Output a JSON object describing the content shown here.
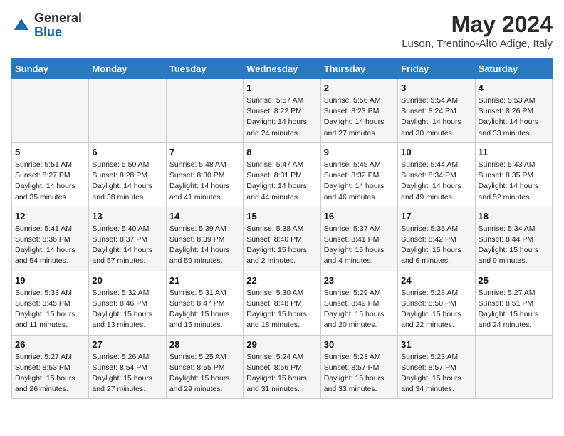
{
  "header": {
    "logo_general": "General",
    "logo_blue": "Blue",
    "month_title": "May 2024",
    "location": "Luson, Trentino-Alto Adige, Italy"
  },
  "days_of_week": [
    "Sunday",
    "Monday",
    "Tuesday",
    "Wednesday",
    "Thursday",
    "Friday",
    "Saturday"
  ],
  "weeks": [
    [
      {
        "day": "",
        "sunrise": "",
        "sunset": "",
        "daylight": ""
      },
      {
        "day": "",
        "sunrise": "",
        "sunset": "",
        "daylight": ""
      },
      {
        "day": "",
        "sunrise": "",
        "sunset": "",
        "daylight": ""
      },
      {
        "day": "1",
        "sunrise": "Sunrise: 5:57 AM",
        "sunset": "Sunset: 8:22 PM",
        "daylight": "Daylight: 14 hours and 24 minutes."
      },
      {
        "day": "2",
        "sunrise": "Sunrise: 5:56 AM",
        "sunset": "Sunset: 8:23 PM",
        "daylight": "Daylight: 14 hours and 27 minutes."
      },
      {
        "day": "3",
        "sunrise": "Sunrise: 5:54 AM",
        "sunset": "Sunset: 8:24 PM",
        "daylight": "Daylight: 14 hours and 30 minutes."
      },
      {
        "day": "4",
        "sunrise": "Sunrise: 5:53 AM",
        "sunset": "Sunset: 8:26 PM",
        "daylight": "Daylight: 14 hours and 33 minutes."
      }
    ],
    [
      {
        "day": "5",
        "sunrise": "Sunrise: 5:51 AM",
        "sunset": "Sunset: 8:27 PM",
        "daylight": "Daylight: 14 hours and 35 minutes."
      },
      {
        "day": "6",
        "sunrise": "Sunrise: 5:50 AM",
        "sunset": "Sunset: 8:28 PM",
        "daylight": "Daylight: 14 hours and 38 minutes."
      },
      {
        "day": "7",
        "sunrise": "Sunrise: 5:48 AM",
        "sunset": "Sunset: 8:30 PM",
        "daylight": "Daylight: 14 hours and 41 minutes."
      },
      {
        "day": "8",
        "sunrise": "Sunrise: 5:47 AM",
        "sunset": "Sunset: 8:31 PM",
        "daylight": "Daylight: 14 hours and 44 minutes."
      },
      {
        "day": "9",
        "sunrise": "Sunrise: 5:45 AM",
        "sunset": "Sunset: 8:32 PM",
        "daylight": "Daylight: 14 hours and 46 minutes."
      },
      {
        "day": "10",
        "sunrise": "Sunrise: 5:44 AM",
        "sunset": "Sunset: 8:34 PM",
        "daylight": "Daylight: 14 hours and 49 minutes."
      },
      {
        "day": "11",
        "sunrise": "Sunrise: 5:43 AM",
        "sunset": "Sunset: 8:35 PM",
        "daylight": "Daylight: 14 hours and 52 minutes."
      }
    ],
    [
      {
        "day": "12",
        "sunrise": "Sunrise: 5:41 AM",
        "sunset": "Sunset: 8:36 PM",
        "daylight": "Daylight: 14 hours and 54 minutes."
      },
      {
        "day": "13",
        "sunrise": "Sunrise: 5:40 AM",
        "sunset": "Sunset: 8:37 PM",
        "daylight": "Daylight: 14 hours and 57 minutes."
      },
      {
        "day": "14",
        "sunrise": "Sunrise: 5:39 AM",
        "sunset": "Sunset: 8:39 PM",
        "daylight": "Daylight: 14 hours and 59 minutes."
      },
      {
        "day": "15",
        "sunrise": "Sunrise: 5:38 AM",
        "sunset": "Sunset: 8:40 PM",
        "daylight": "Daylight: 15 hours and 2 minutes."
      },
      {
        "day": "16",
        "sunrise": "Sunrise: 5:37 AM",
        "sunset": "Sunset: 8:41 PM",
        "daylight": "Daylight: 15 hours and 4 minutes."
      },
      {
        "day": "17",
        "sunrise": "Sunrise: 5:35 AM",
        "sunset": "Sunset: 8:42 PM",
        "daylight": "Daylight: 15 hours and 6 minutes."
      },
      {
        "day": "18",
        "sunrise": "Sunrise: 5:34 AM",
        "sunset": "Sunset: 8:44 PM",
        "daylight": "Daylight: 15 hours and 9 minutes."
      }
    ],
    [
      {
        "day": "19",
        "sunrise": "Sunrise: 5:33 AM",
        "sunset": "Sunset: 8:45 PM",
        "daylight": "Daylight: 15 hours and 11 minutes."
      },
      {
        "day": "20",
        "sunrise": "Sunrise: 5:32 AM",
        "sunset": "Sunset: 8:46 PM",
        "daylight": "Daylight: 15 hours and 13 minutes."
      },
      {
        "day": "21",
        "sunrise": "Sunrise: 5:31 AM",
        "sunset": "Sunset: 8:47 PM",
        "daylight": "Daylight: 15 hours and 15 minutes."
      },
      {
        "day": "22",
        "sunrise": "Sunrise: 5:30 AM",
        "sunset": "Sunset: 8:48 PM",
        "daylight": "Daylight: 15 hours and 18 minutes."
      },
      {
        "day": "23",
        "sunrise": "Sunrise: 5:29 AM",
        "sunset": "Sunset: 8:49 PM",
        "daylight": "Daylight: 15 hours and 20 minutes."
      },
      {
        "day": "24",
        "sunrise": "Sunrise: 5:28 AM",
        "sunset": "Sunset: 8:50 PM",
        "daylight": "Daylight: 15 hours and 22 minutes."
      },
      {
        "day": "25",
        "sunrise": "Sunrise: 5:27 AM",
        "sunset": "Sunset: 8:51 PM",
        "daylight": "Daylight: 15 hours and 24 minutes."
      }
    ],
    [
      {
        "day": "26",
        "sunrise": "Sunrise: 5:27 AM",
        "sunset": "Sunset: 8:53 PM",
        "daylight": "Daylight: 15 hours and 26 minutes."
      },
      {
        "day": "27",
        "sunrise": "Sunrise: 5:26 AM",
        "sunset": "Sunset: 8:54 PM",
        "daylight": "Daylight: 15 hours and 27 minutes."
      },
      {
        "day": "28",
        "sunrise": "Sunrise: 5:25 AM",
        "sunset": "Sunset: 8:55 PM",
        "daylight": "Daylight: 15 hours and 29 minutes."
      },
      {
        "day": "29",
        "sunrise": "Sunrise: 5:24 AM",
        "sunset": "Sunset: 8:56 PM",
        "daylight": "Daylight: 15 hours and 31 minutes."
      },
      {
        "day": "30",
        "sunrise": "Sunrise: 5:23 AM",
        "sunset": "Sunset: 8:57 PM",
        "daylight": "Daylight: 15 hours and 33 minutes."
      },
      {
        "day": "31",
        "sunrise": "Sunrise: 5:23 AM",
        "sunset": "Sunset: 8:57 PM",
        "daylight": "Daylight: 15 hours and 34 minutes."
      },
      {
        "day": "",
        "sunrise": "",
        "sunset": "",
        "daylight": ""
      }
    ]
  ]
}
